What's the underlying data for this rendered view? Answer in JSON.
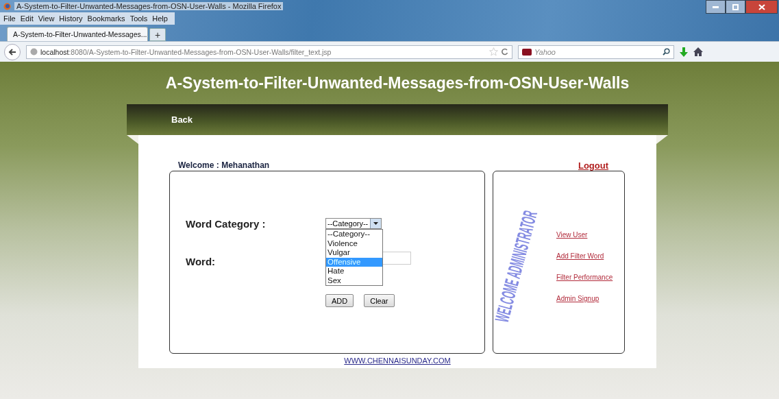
{
  "browser": {
    "window_title": "A-System-to-Filter-Unwanted-Messages-from-OSN-User-Walls - Mozilla Firefox",
    "menu": [
      "File",
      "Edit",
      "View",
      "History",
      "Bookmarks",
      "Tools",
      "Help"
    ],
    "tab": {
      "title": "A-System-to-Filter-Unwanted-Messages..."
    },
    "new_tab": "+",
    "address": {
      "host": "localhost",
      "path": ":8080/A-System-to-Filter-Unwanted-Messages-from-OSN-User-Walls/filter_text.jsp"
    },
    "search": {
      "placeholder": "Yahoo"
    }
  },
  "page": {
    "heading": "A-System-to-Filter-Unwanted-Messages-from-OSN-User-Walls",
    "nav": [
      {
        "label": "Back"
      }
    ],
    "welcome": "Welcome : Mehanathan",
    "logout": "Logout",
    "form": {
      "category_label": "Word Category :",
      "category_value": "--Category--",
      "options": [
        {
          "label": "--Category--",
          "selected": false
        },
        {
          "label": "Violence",
          "selected": false
        },
        {
          "label": "Vulgar",
          "selected": false
        },
        {
          "label": "Offensive",
          "selected": true
        },
        {
          "label": "Hate",
          "selected": false
        },
        {
          "label": "Sex",
          "selected": false
        }
      ],
      "word_label": "Word:",
      "buttons": [
        "ADD",
        "Clear"
      ]
    },
    "side": {
      "banner": "WELCOME ADMINISTRATOR",
      "links": [
        "View User",
        "Add Filter Word",
        "Filter Performance",
        "Admin Signup"
      ]
    },
    "footer": "WWW.CHENNAISUNDAY.COM"
  }
}
